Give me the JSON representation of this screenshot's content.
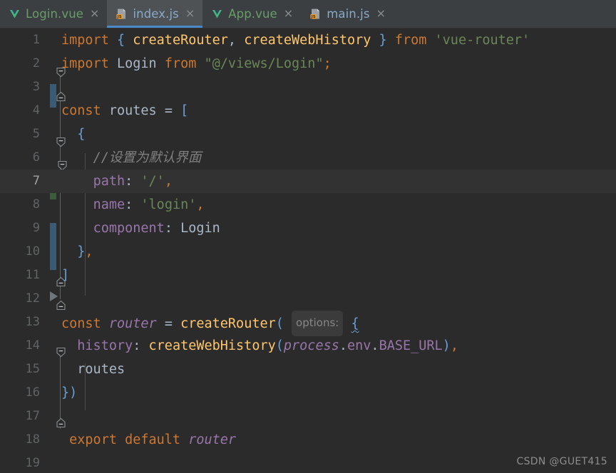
{
  "window": {
    "theme": "darcula",
    "background": "#2b2b2b",
    "accent": "#4a88c7"
  },
  "tabbar": {
    "tabs": [
      {
        "label": "Login.vue",
        "icon": "vue-file-icon",
        "active": false,
        "close_glyph": "×"
      },
      {
        "label": "index.js",
        "icon": "js-file-icon",
        "active": true,
        "close_glyph": "×"
      },
      {
        "label": "App.vue",
        "icon": "vue-file-icon",
        "active": false,
        "close_glyph": "×"
      },
      {
        "label": "main.js",
        "icon": "js-file-icon",
        "active": false,
        "close_glyph": "×"
      }
    ]
  },
  "editor": {
    "current_line": 7,
    "inline_hint": "options:",
    "line_numbers": [
      "1",
      "2",
      "3",
      "4",
      "5",
      "6",
      "7",
      "8",
      "9",
      "10",
      "11",
      "12",
      "13",
      "14",
      "15",
      "16",
      "17",
      "18",
      "19"
    ],
    "lines": [
      {
        "n": "1",
        "text": "import { createRouter, createWebHistory } from 'vue-router'"
      },
      {
        "n": "2",
        "text": "import Login from \"@/views/Login\";"
      },
      {
        "n": "3",
        "text": ""
      },
      {
        "n": "4",
        "text": "const routes = ["
      },
      {
        "n": "5",
        "text": "  {"
      },
      {
        "n": "6",
        "text": "    //设置为默认界面"
      },
      {
        "n": "7",
        "text": "    path: '/',"
      },
      {
        "n": "8",
        "text": "    name: 'login',"
      },
      {
        "n": "9",
        "text": "    component: Login"
      },
      {
        "n": "10",
        "text": "  },"
      },
      {
        "n": "11",
        "text": "]"
      },
      {
        "n": "12",
        "text": ""
      },
      {
        "n": "13",
        "text": "const router = createRouter( options: {"
      },
      {
        "n": "14",
        "text": "  history: createWebHistory(process.env.BASE_URL),"
      },
      {
        "n": "15",
        "text": "  routes"
      },
      {
        "n": "16",
        "text": "})"
      },
      {
        "n": "17",
        "text": ""
      },
      {
        "n": "18",
        "text": " export default router"
      },
      {
        "n": "19",
        "text": ""
      }
    ],
    "tokens": {
      "line1": {
        "kw_import": "import",
        "brace_open": "{",
        "fn1": "createRouter",
        "comma": ",",
        "fn2": "createWebHistory",
        "brace_close": "}",
        "kw_from": "from",
        "module": "'vue-router'"
      },
      "line2": {
        "kw_import": "import",
        "ident": "Login",
        "kw_from": "from",
        "path": "\"@/views/Login\"",
        "semi": ";"
      },
      "line4": {
        "kw_const": "const",
        "ident": "routes",
        "eq": "=",
        "bracket": "["
      },
      "line5": {
        "brace": "{"
      },
      "line6": {
        "comment": "//设置为默认界面"
      },
      "line7": {
        "key": "path",
        "colon": ":",
        "value": "'/'",
        "comma": ","
      },
      "line8": {
        "key": "name",
        "colon": ":",
        "value": "'login'",
        "comma": ","
      },
      "line9": {
        "key": "component",
        "colon": ":",
        "value": "Login"
      },
      "line10": {
        "brace": "}",
        "comma": ","
      },
      "line11": {
        "bracket": "]"
      },
      "line13": {
        "kw_const": "const",
        "ident": "router",
        "eq": "=",
        "fn": "createRouter",
        "paren": "(",
        "hint": "options:",
        "brace": "{"
      },
      "line14": {
        "key": "history",
        "colon": ":",
        "fn": "createWebHistory",
        "paren_open": "(",
        "obj": "process",
        "dot1": ".",
        "prop1": "env",
        "dot2": ".",
        "prop2": "BASE_URL",
        "paren_close": ")",
        "comma": ","
      },
      "line15": {
        "ident": "routes"
      },
      "line16": {
        "brace": "}",
        "paren": ")"
      },
      "line18": {
        "kw_export": "export",
        "kw_default": "default",
        "ident": "router"
      }
    },
    "gutter_markers": [
      {
        "line": "2",
        "type": "modified",
        "color": "#3b5a74"
      },
      {
        "line": "6",
        "type": "added",
        "color": "#3a5c3a"
      },
      {
        "line": "8",
        "type": "modified",
        "color": "#3b5a74"
      },
      {
        "line": "9",
        "type": "modified",
        "color": "#3b5a74"
      }
    ]
  },
  "watermark": {
    "text": "CSDN @GUET415"
  }
}
